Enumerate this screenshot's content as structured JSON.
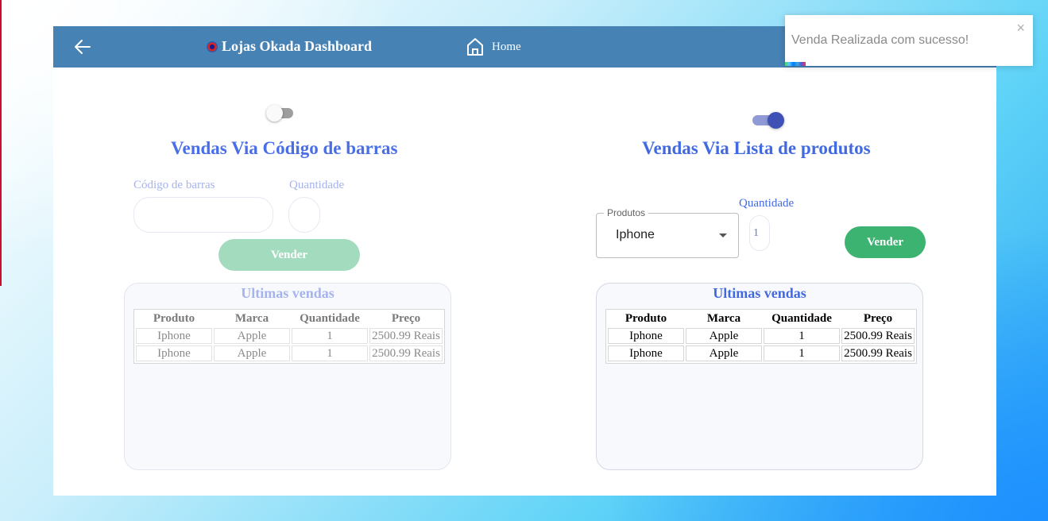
{
  "header": {
    "brand_title": "Lojas Okada Dashboard",
    "home_label": "Home"
  },
  "barcode_sale": {
    "title": "Vendas Via Código de barras",
    "toggle_on": false,
    "barcode_label": "Código de barras",
    "barcode_value": "",
    "quantity_label": "Quantidade",
    "quantity_value": "",
    "sell_button": "Vender",
    "recent_title": "Ultimas vendas",
    "table": {
      "columns": [
        "Produto",
        "Marca",
        "Quantidade",
        "Preço"
      ],
      "rows": [
        [
          "Iphone",
          "Apple",
          "1",
          "2500.99 Reais"
        ],
        [
          "Iphone",
          "Apple",
          "1",
          "2500.99 Reais"
        ]
      ]
    }
  },
  "list_sale": {
    "title": "Vendas Via Lista de produtos",
    "toggle_on": true,
    "products_label": "Produtos",
    "products_selected": "Iphone",
    "quantity_label": "Quantidade",
    "quantity_value": "1",
    "sell_button": "Vender",
    "recent_title": "Ultimas vendas",
    "table": {
      "columns": [
        "Produto",
        "Marca",
        "Quantidade",
        "Preço"
      ],
      "rows": [
        [
          "Iphone",
          "Apple",
          "1",
          "2500.99 Reais"
        ],
        [
          "Iphone",
          "Apple",
          "1",
          "2500.99 Reais"
        ]
      ]
    }
  },
  "toast": {
    "message": "Venda Realizada com sucesso!",
    "close": "×"
  },
  "colors": {
    "navbar": "#4682b4",
    "accent_blue": "#4169e1",
    "sell_green": "#3cb371",
    "switch_on": "#3f51b5"
  }
}
